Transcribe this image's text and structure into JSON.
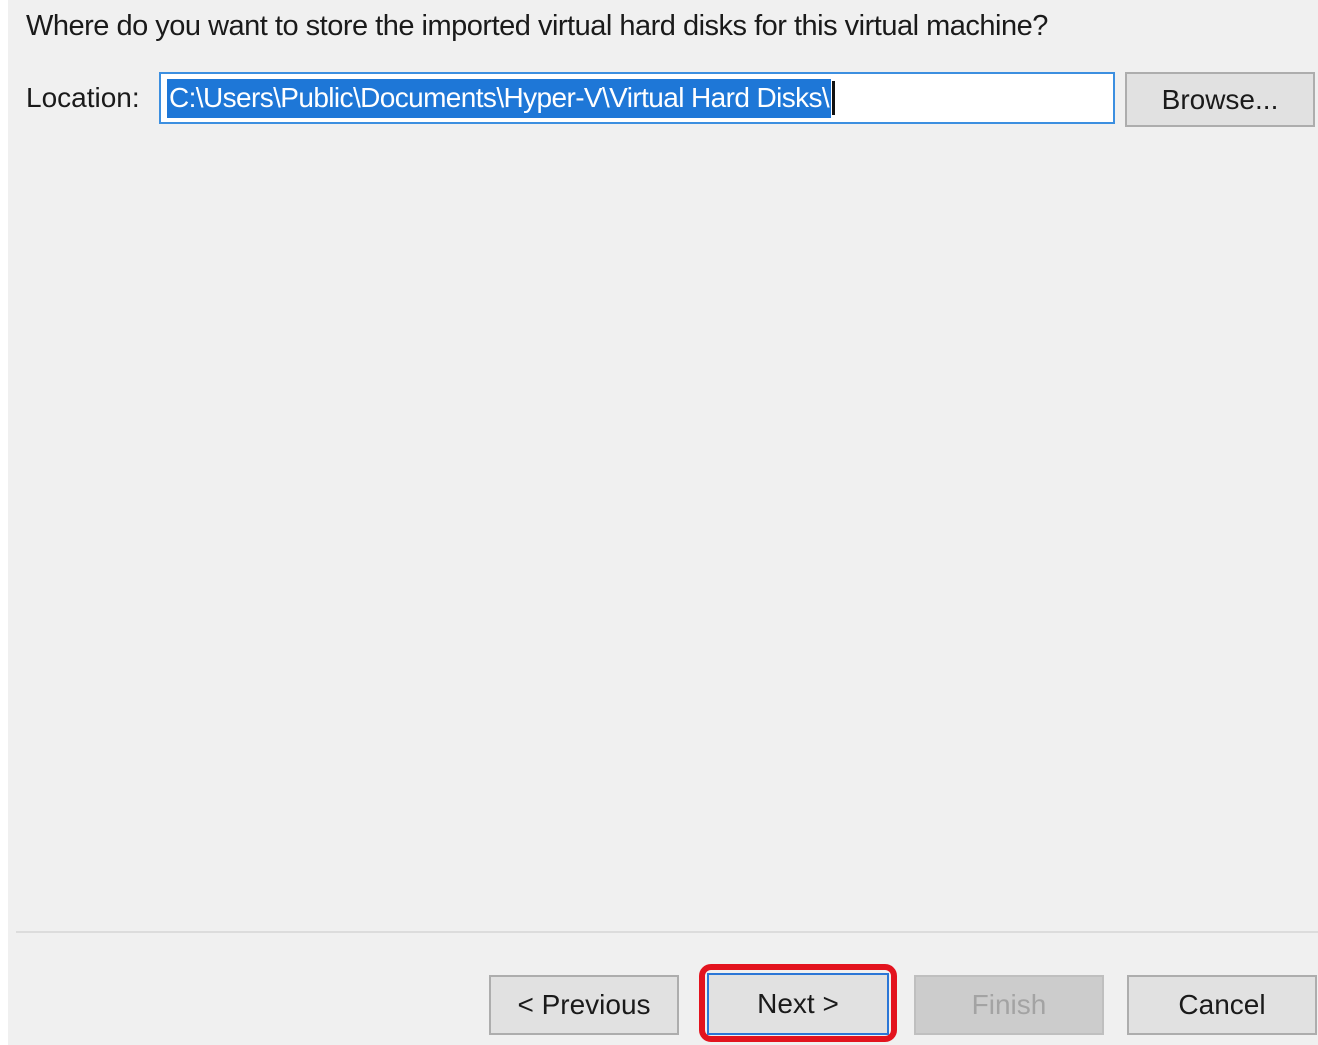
{
  "wizard": {
    "question": "Where do you want to store the imported virtual hard disks for this virtual machine?",
    "location_label": "Location:",
    "location_value": "C:\\Users\\Public\\Documents\\Hyper-V\\Virtual Hard Disks\\",
    "browse_label": "Browse..."
  },
  "footer": {
    "previous_label": "< Previous",
    "next_label": "Next >",
    "finish_label": "Finish",
    "finish_enabled": false,
    "cancel_label": "Cancel",
    "highlighted_button": "next"
  },
  "colors": {
    "panel_background": "#f0f0f0",
    "selection": "#1e77d7",
    "input_border": "#3c8fe0",
    "highlight": "#e3131e"
  }
}
